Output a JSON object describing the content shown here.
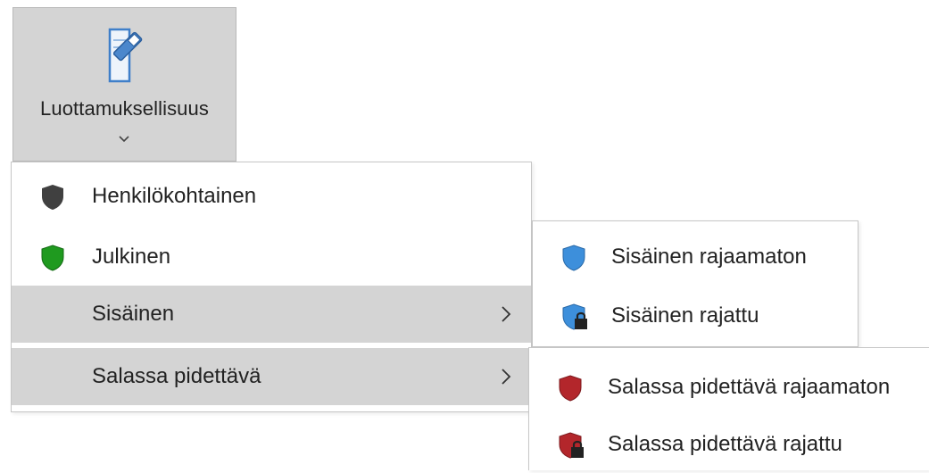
{
  "ribbon": {
    "button_label": "Luottamuksellisuus",
    "icon": "document-clip-icon",
    "dropdown_icon": "chevron-down-icon"
  },
  "main_menu": {
    "items": [
      {
        "label": "Henkilökohtainen",
        "icon": "shield-icon",
        "icon_color": "#404040",
        "has_submenu": false
      },
      {
        "label": "Julkinen",
        "icon": "shield-icon",
        "icon_color": "#1f9a1f",
        "has_submenu": false
      },
      {
        "label": "Sisäinen",
        "icon": "",
        "has_submenu": true,
        "highlighted": true
      },
      {
        "label": "Salassa pidettävä",
        "icon": "",
        "has_submenu": true,
        "highlighted": true
      }
    ]
  },
  "sub_internal": {
    "items": [
      {
        "label": "Sisäinen rajaamaton",
        "icon": "shield-icon",
        "icon_color": "#3d8fdb"
      },
      {
        "label": "Sisäinen rajattu",
        "icon": "shield-lock-icon",
        "icon_color": "#3d8fdb"
      }
    ]
  },
  "sub_confidential": {
    "items": [
      {
        "label": "Salassa pidettävä rajaamaton",
        "icon": "shield-icon",
        "icon_color": "#b3262b"
      },
      {
        "label": "Salassa pidettävä rajattu",
        "icon": "shield-lock-icon",
        "icon_color": "#b3262b"
      }
    ]
  }
}
